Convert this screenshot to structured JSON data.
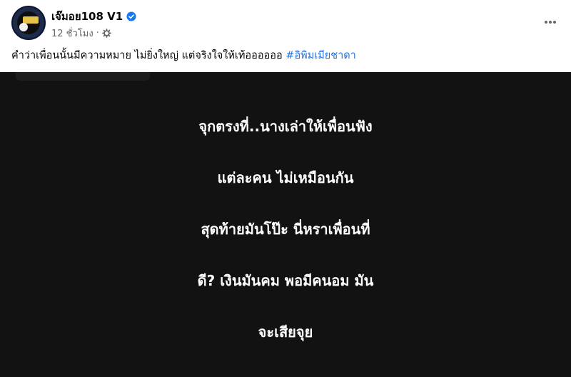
{
  "post": {
    "author": {
      "name": "เจ๊มอย108 V1",
      "verified": true,
      "avatar_icon": "avatar-logo",
      "accent_color": "#1c2b4a"
    },
    "meta": {
      "timestamp": "12 ชั่วโมง",
      "separator": "·",
      "audience_icon": "public-gear-icon"
    },
    "more_icon": "more-horizontal-icon",
    "caption": {
      "text": "คำว่าเพื่อนนั้นมีความหมาย ไม่ยิ่งใหญ่ แต่จริงใจให้เท้ออออออ ",
      "hashtag": "#อิพิมเมียชาดา",
      "hashtag_color": "#216fdb"
    },
    "media": {
      "background_color": "#121212",
      "text_color": "#ffffff",
      "lines": [
        "จุกตรงที่..นางเล่าให้เพื่อนฟัง",
        "แต่ละคน ไม่เหมือนกัน",
        "สุดท้ายมันโป๊ะ นี่หราเพื่อนที่",
        "ดี? เงินมันคม พอมีคนอม มัน",
        "จะเสียจุย"
      ]
    }
  }
}
